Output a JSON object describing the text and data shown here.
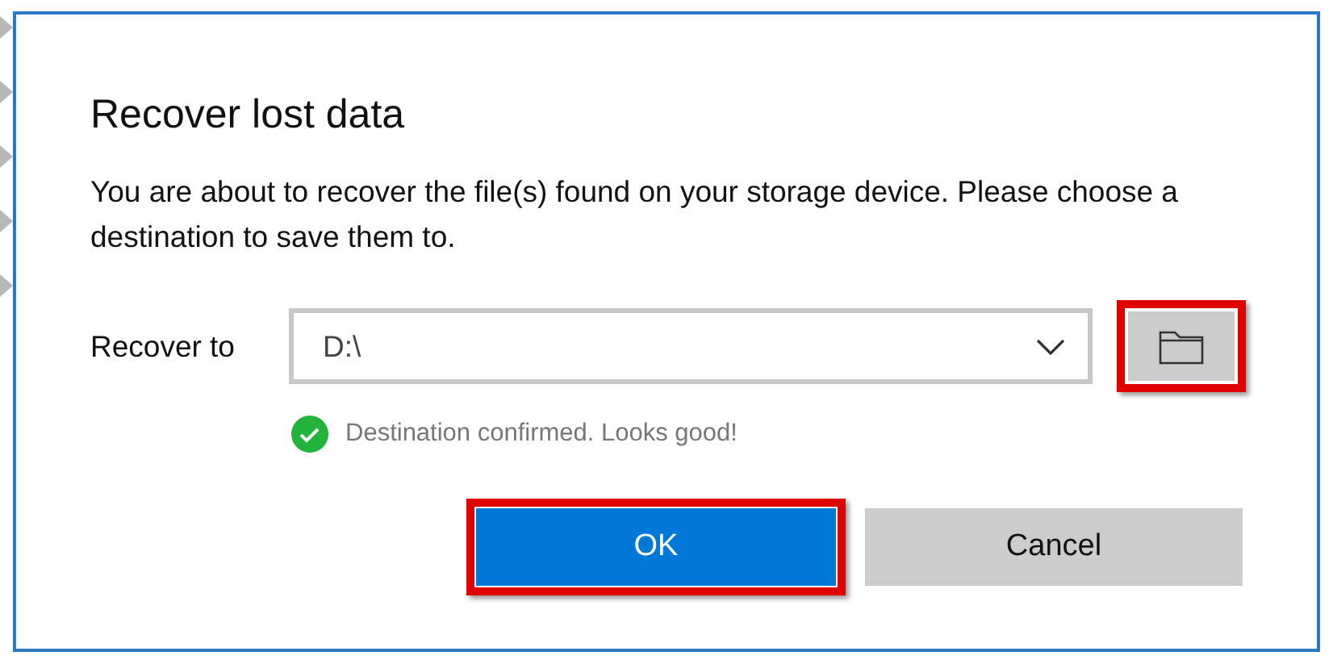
{
  "dialog": {
    "title": "Recover lost data",
    "message": "You are about to recover the file(s) found on your storage device. Please choose a destination to save them to.",
    "destination": {
      "label": "Recover to",
      "value": "D:\\"
    },
    "status": {
      "kind": "success",
      "text": "Destination confirmed. Looks good!"
    },
    "buttons": [
      {
        "label": "OK",
        "kind": "primary"
      },
      {
        "label": "Cancel",
        "kind": "secondary"
      }
    ]
  }
}
